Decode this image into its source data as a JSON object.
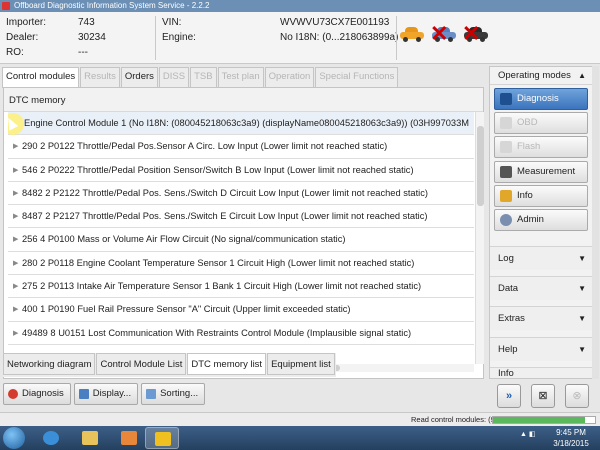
{
  "window": {
    "title": "Offboard Diagnostic Information System Service - 2.2.2"
  },
  "header": {
    "importer_label": "Importer:",
    "importer_value": "743",
    "dealer_label": "Dealer:",
    "dealer_value": "30234",
    "ro_label": "RO:",
    "ro_value": "---",
    "vin_label": "VIN:",
    "vin_value": "WVWVU73CX7E001193",
    "engine_label": "Engine:",
    "engine_value": "No I18N: (0...218063899a)",
    "icons": [
      "car-icon",
      "car-crossed-icon",
      "car-crossed-icon"
    ]
  },
  "tabs": [
    {
      "label": "Control modules",
      "state": "active"
    },
    {
      "label": "Results",
      "state": "disabled"
    },
    {
      "label": "Orders",
      "state": "normal"
    },
    {
      "label": "DISS",
      "state": "disabled"
    },
    {
      "label": "TSB",
      "state": "disabled"
    },
    {
      "label": "Test plan",
      "state": "disabled"
    },
    {
      "label": "Operation",
      "state": "disabled"
    },
    {
      "label": "Special Functions",
      "state": "disabled"
    }
  ],
  "main": {
    "section_title": "DTC memory",
    "ecu_row": "Engine Control Module 1 (No I18N: (080045218063c3a9) (displayName080045218063c3a9)) (03H997033M",
    "dtc_rows": [
      "290  2  P0122  Throttle/Pedal Pos.Sensor A Circ. Low Input  (Lower limit not reached   static)",
      "546  2  P0222  Throttle/Pedal Position Sensor/Switch B Low Input  (Lower limit not reached   static)",
      "8482  2  P2122  Throttle/Pedal Pos. Sens./Switch D Circuit Low Input  (Lower limit not reached   static)",
      "8487  2  P2127  Throttle/Pedal Pos. Sens./Switch E Circuit Low Input  (Lower limit not reached   static)",
      "256  4  P0100  Mass or Volume Air Flow Circuit  (No signal/communication   static)",
      "280  2  P0118  Engine Coolant Temperature Sensor 1 Circuit High  (Lower limit not reached   static)",
      "275  2  P0113  Intake Air Temperature Sensor 1 Bank 1 Circuit High  (Lower limit not reached   static)",
      "400  1  P0190  Fuel Rail Pressure Sensor \"A\" Circuit  (Upper limit exceeded   static)",
      "49489  8  U0151  Lost Communication With Restraints Control Module  (Implausible signal   static)"
    ]
  },
  "bottom_tabs": [
    {
      "label": "Networking diagram",
      "active": false
    },
    {
      "label": "Control Module List",
      "active": false
    },
    {
      "label": "DTC memory list",
      "active": true
    },
    {
      "label": "Equipment list",
      "active": false
    }
  ],
  "actions": {
    "diagnosis": "Diagnosis",
    "display": "Display...",
    "sorting": "Sorting..."
  },
  "right_panel": {
    "title": "Operating modes",
    "modes": [
      {
        "label": "Diagnosis",
        "state": "active",
        "icon": "stethoscope-icon"
      },
      {
        "label": "OBD",
        "state": "disabled",
        "icon": "obd-icon"
      },
      {
        "label": "Flash",
        "state": "disabled",
        "icon": "flash-icon"
      },
      {
        "label": "Measurement",
        "state": "normal",
        "icon": "meter-icon"
      },
      {
        "label": "Info",
        "state": "normal",
        "icon": "info-icon"
      },
      {
        "label": "Admin",
        "state": "normal",
        "icon": "admin-icon"
      }
    ],
    "sections": [
      "Log",
      "Data",
      "Extras",
      "Help",
      "Info"
    ]
  },
  "status": {
    "message": "Read control modules: (90%)",
    "progress": 0.9
  },
  "taskbar": {
    "time": "9:45 PM",
    "date": "3/18/2015"
  },
  "colors": {
    "active_blue": "#3b74bd",
    "error_red": "#cc0000",
    "progress_green": "#5cb85c"
  }
}
